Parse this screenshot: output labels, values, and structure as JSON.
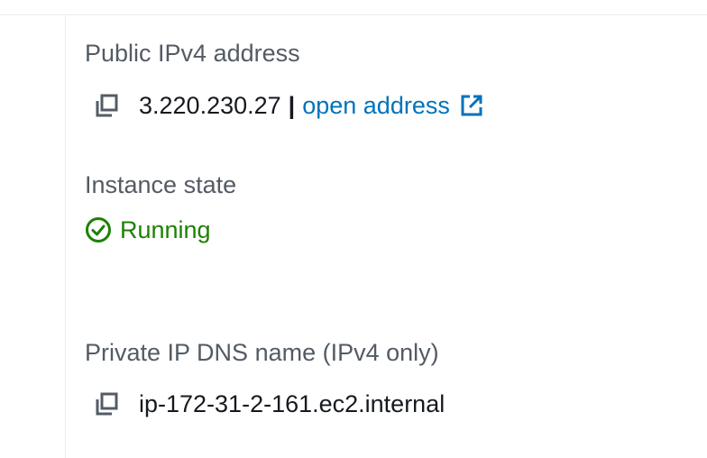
{
  "public_ipv4": {
    "label": "Public IPv4 address",
    "value": "3.220.230.27",
    "separator": "|",
    "link_label": "open address",
    "copy_icon": "copy-icon",
    "external_icon": "external-link-icon"
  },
  "instance_state": {
    "label": "Instance state",
    "value": "Running",
    "status_icon": "check-circle-icon",
    "status_color": "#1d8102"
  },
  "private_dns": {
    "label": "Private IP DNS name (IPv4 only)",
    "value": "ip-172-31-2-161.ec2.internal",
    "copy_icon": "copy-icon"
  },
  "colors": {
    "label": "#545b64",
    "text": "#16191f",
    "link": "#0073bb",
    "success": "#1d8102",
    "border": "#eaeded"
  }
}
